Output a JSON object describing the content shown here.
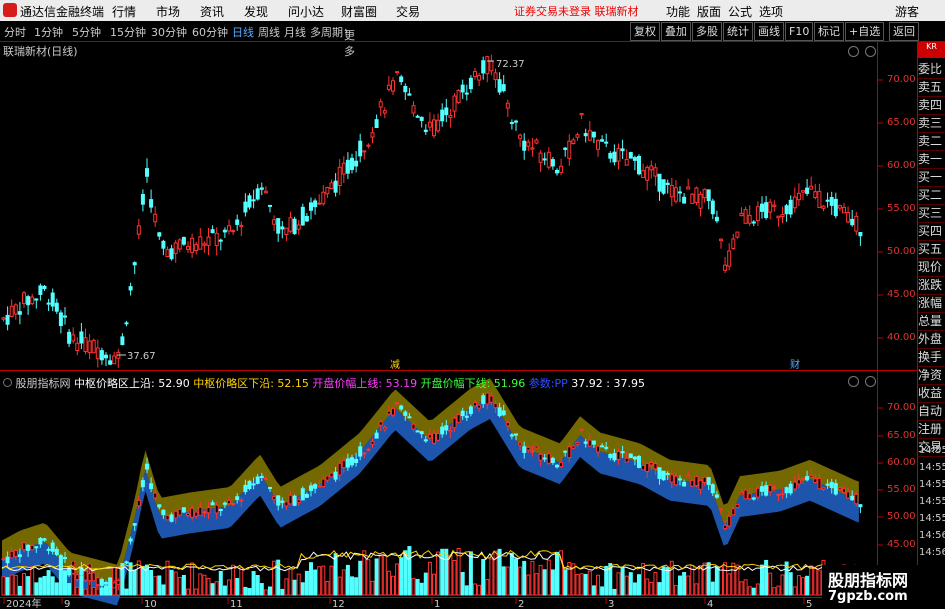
{
  "app": {
    "name": "通达信金融终端",
    "login_warning": "证券交易未登录",
    "stock_label": "联瑞新材"
  },
  "menu": [
    "行情",
    "市场",
    "资讯",
    "发现",
    "问小达",
    "财富圈",
    "交易"
  ],
  "top_right": [
    "功能",
    "版面",
    "公式",
    "选项",
    "游客"
  ],
  "periods": [
    "分时",
    "1分钟",
    "5分钟",
    "15分钟",
    "30分钟",
    "60分钟",
    "日线",
    "周线",
    "月线",
    "多周期",
    "更多"
  ],
  "active_period": "日线",
  "toolbar_right": [
    "复权",
    "叠加",
    "多股",
    "统计",
    "画线",
    "F10",
    "标记",
    "+自选",
    "返回"
  ],
  "main_chart": {
    "title": "联瑞新材(日线)",
    "high_label": "72.37",
    "low_label": "37.67",
    "marker_1": "减",
    "marker_2": "财",
    "price_axis": [
      "70.00",
      "65.00",
      "60.00",
      "55.00",
      "50.00",
      "45.00",
      "40.00"
    ]
  },
  "indicator": {
    "name": "股朋指标网",
    "l1": "中枢价略区上沿: 52.90",
    "l2": "中枢价略区下沿: 52.15",
    "l3": "开盘价幅上线: 53.19",
    "l4": "开盘价幅下线: 51.96",
    "l5": "参数:PP",
    "l6": "37.92",
    "l7": "37.95",
    "axis": [
      "70.00",
      "65.00",
      "60.00",
      "55.00",
      "50.00",
      "45.00"
    ]
  },
  "x_axis": [
    "2024年",
    "9",
    "10",
    "11",
    "12",
    "1",
    "2",
    "3",
    "4",
    "5"
  ],
  "right_panel": [
    "委比",
    "卖五",
    "卖四",
    "卖三",
    "卖二",
    "卖一",
    "买一",
    "买二",
    "买三",
    "买四",
    "买五",
    "现价",
    "涨跌",
    "涨幅",
    "总量",
    "外盘",
    "换手",
    "净资",
    "收益",
    "自动",
    "注册",
    "交易"
  ],
  "time_axis": [
    "14:55",
    "14:55",
    "14:55",
    "14:55",
    "14:55",
    "14:56",
    "14:56",
    "14:56"
  ],
  "watermark": {
    "line1": "股朋指标网",
    "line2": "7gpzb.com"
  },
  "colors": {
    "up": "#ff3232",
    "down": "#54ffff",
    "band_upper": "#7a6f00",
    "band_lower": "#1e5ab4",
    "menu_warning": "#e00000"
  }
}
